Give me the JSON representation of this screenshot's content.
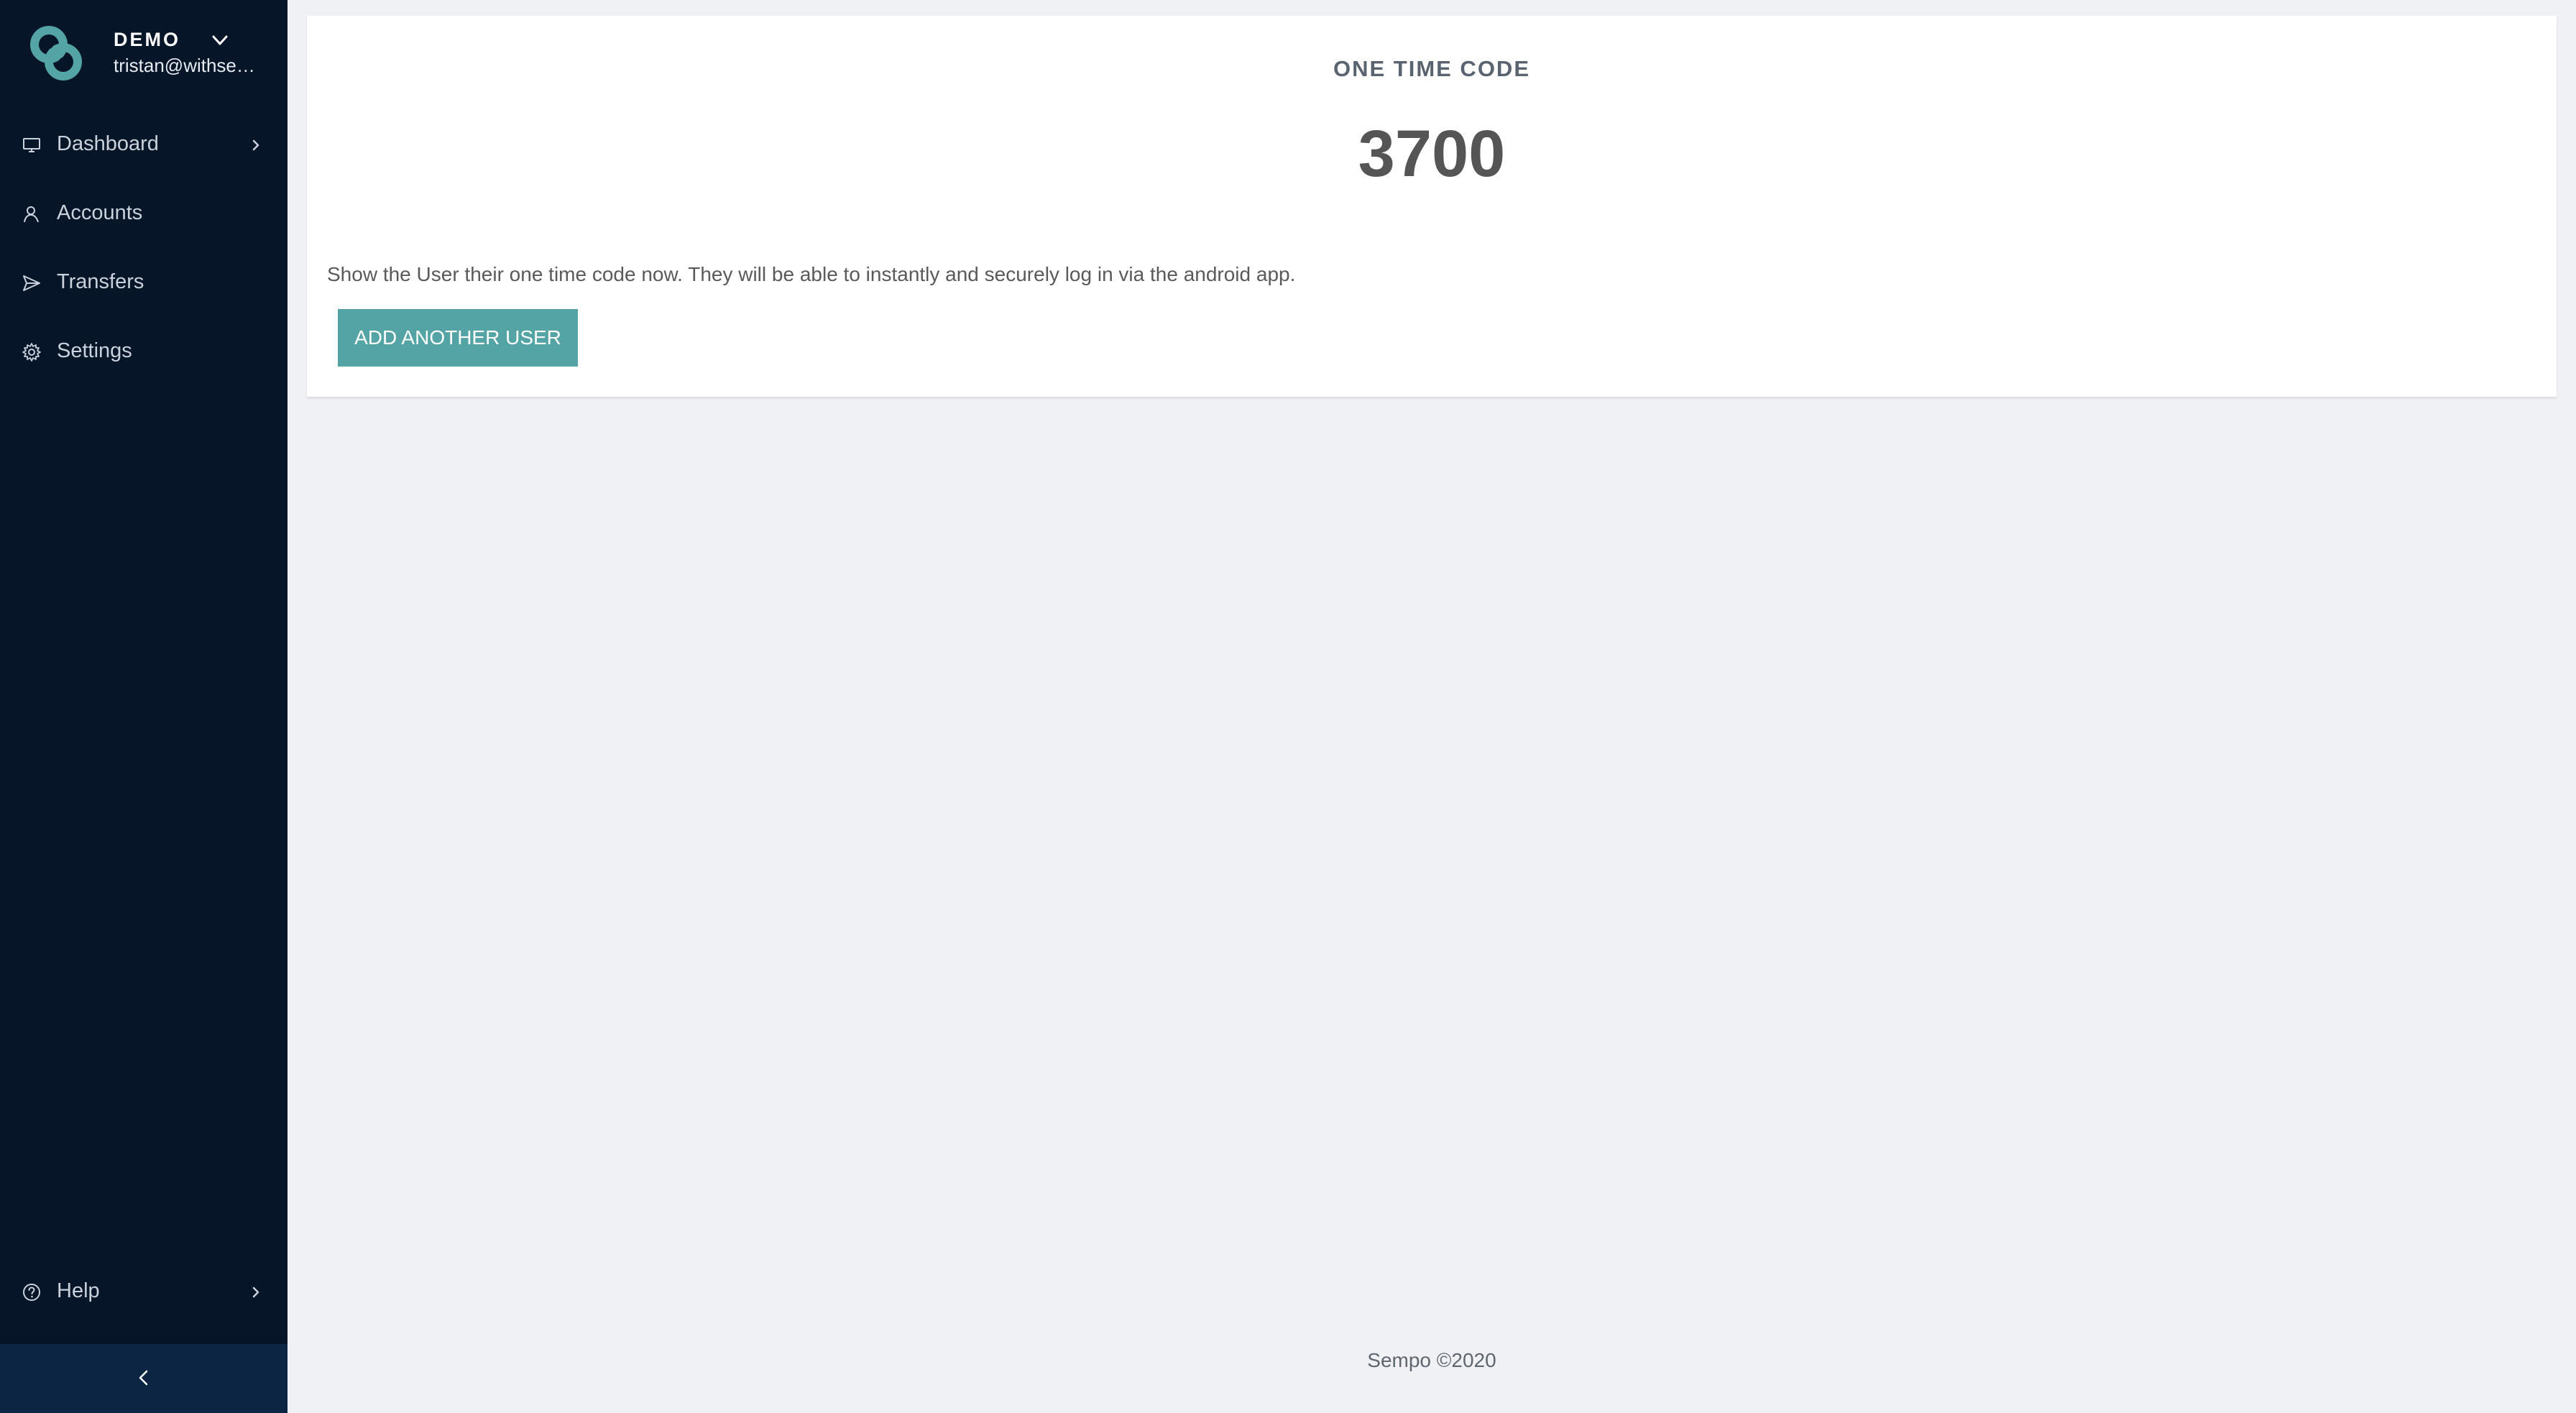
{
  "org": {
    "name": "DEMO",
    "email": "tristan@withsem..."
  },
  "nav": {
    "items": [
      {
        "label": "Dashboard",
        "icon": "monitor-icon",
        "has_arrow": true
      },
      {
        "label": "Accounts",
        "icon": "user-icon",
        "has_arrow": false
      },
      {
        "label": "Transfers",
        "icon": "send-icon",
        "has_arrow": false
      },
      {
        "label": "Settings",
        "icon": "gear-icon",
        "has_arrow": false
      }
    ],
    "help": {
      "label": "Help",
      "icon": "question-circle-icon",
      "has_arrow": true
    }
  },
  "main": {
    "title": "ONE TIME CODE",
    "code": "3700",
    "message": "Show the User their one time code now. They will be able to instantly and securely log in via the android app.",
    "button_label": "ADD ANOTHER USER"
  },
  "footer": {
    "text": "Sempo ©2020"
  },
  "colors": {
    "sidebar_bg": "#061527",
    "collapse_bg": "#0b2542",
    "accent": "#54a4a5",
    "page_bg": "#f0f1f5"
  }
}
